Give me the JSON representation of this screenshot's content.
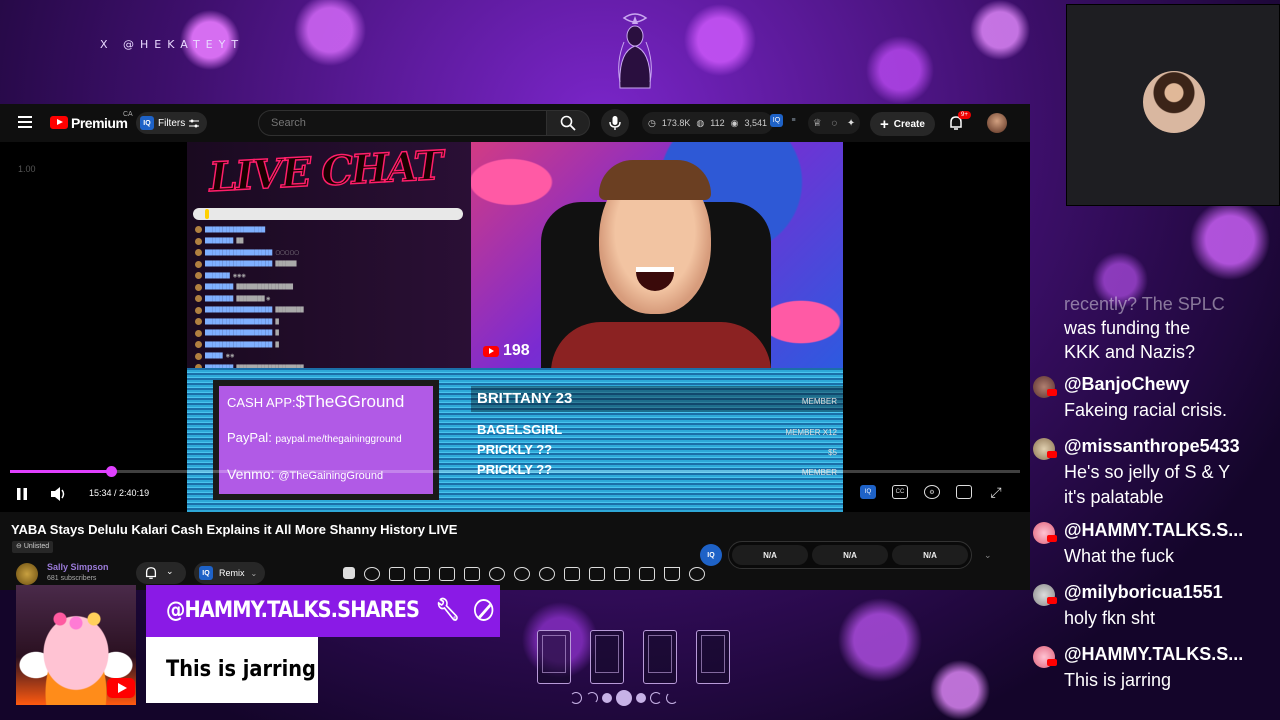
{
  "overlay": {
    "handle": "X @HEKATEYT"
  },
  "youtube": {
    "brand": "Premium",
    "region": "CA",
    "filters_label": "Filters",
    "iq_label": "IQ",
    "search_placeholder": "Search",
    "stats": {
      "views": "173.8K",
      "likes": "112",
      "viewers": "3,541"
    },
    "create_label": "Create",
    "notification_count": "9+"
  },
  "player": {
    "speed": "1.00",
    "current_time": "15:34",
    "total_time": "2:40:19",
    "progress_fraction": 0.1,
    "live_chat_title": "LIVE CHAT",
    "embedded_viewer_count": "198",
    "donations": {
      "cashapp_label": "CASH APP:",
      "cashapp_value": "$TheGGround",
      "paypal_label": "PayPal:",
      "paypal_value": "paypal.me/thegainingground",
      "venmo_label": "Venmo:",
      "venmo_value": "@TheGainingGround"
    },
    "members": [
      {
        "name": "BRITTANY 23",
        "tag": "MEMBER"
      },
      {
        "name": "BAGELSGIRL",
        "tag": "MEMBER X12"
      },
      {
        "name": "PRICKLY ??",
        "tag": "$5"
      },
      {
        "name": "PRICKLY ??",
        "tag": "MEMBER"
      }
    ]
  },
  "video": {
    "title": "YABA Stays Delulu Kalari Cash Explains it All More Shanny History LIVE",
    "visibility": "Unlisted",
    "channel_name": "Sally Simpson",
    "subscribers": "681 subscribers",
    "remix_label": "Remix",
    "na_values": [
      "N/A",
      "N/A",
      "N/A"
    ]
  },
  "chat": {
    "partial_text_line1": "recently? The SPLC",
    "partial_text_line2": "was funding the",
    "partial_text_line3": "KKK and Nazis?",
    "messages": [
      {
        "user": "@BanjoChewy",
        "text": "Fakeing racial crisis."
      },
      {
        "user": "@missanthrope5433",
        "text": "He's so jelly of S & Y",
        "text2": "it's palatable"
      },
      {
        "user": "@HAMMY.TALKS.S...",
        "text": "What the fuck"
      },
      {
        "user": "@milyboricua1551",
        "text": "holy fkn sht"
      },
      {
        "user": "@HAMMY.TALKS.S...",
        "text": "This is jarring"
      }
    ]
  },
  "featured": {
    "username": "@HAMMY.TALKS.SHARES",
    "message": "This is jarring"
  },
  "colors": {
    "accent_purple": "#8a1ae6",
    "progress": "#e040ff",
    "yt_red": "#ff0000"
  }
}
